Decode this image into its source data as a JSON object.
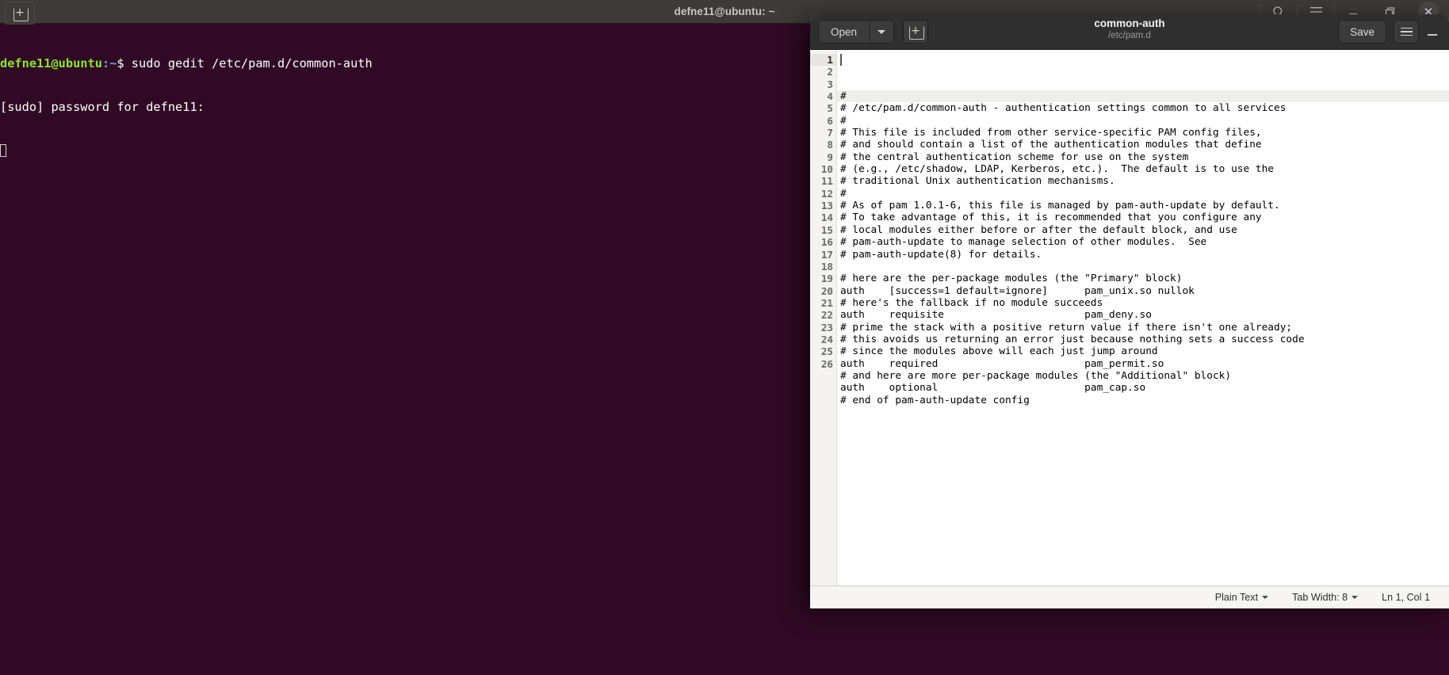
{
  "terminal": {
    "title": "defne11@ubuntu: ~",
    "newtab_icon": "new-tab-icon",
    "search_icon": "search-icon",
    "menu_icon": "hamburger-menu-icon",
    "minimize_icon": "minimize-icon",
    "maximize_icon": "maximize-icon",
    "close_icon": "close-icon",
    "prompt_user": "defne11@ubuntu",
    "prompt_path": ":~",
    "prompt_symbol": "$ ",
    "command": "sudo gedit /etc/pam.d/common-auth",
    "password_prompt": "[sudo] password for defne11:"
  },
  "gedit": {
    "open_label": "Open",
    "open_dropdown_icon": "chevron-down-icon",
    "newtab_icon": "new-tab-icon",
    "doc_title": "common-auth",
    "doc_path": "/etc/pam.d",
    "save_label": "Save",
    "menu_icon": "hamburger-menu-icon",
    "minimize_icon": "minimize-icon",
    "statusbar": {
      "language": "Plain Text",
      "tab_width": "Tab Width: 8",
      "cursor_position": "Ln 1, Col 1"
    },
    "lines": [
      "#",
      "# /etc/pam.d/common-auth - authentication settings common to all services",
      "#",
      "# This file is included from other service-specific PAM config files,",
      "# and should contain a list of the authentication modules that define",
      "# the central authentication scheme for use on the system",
      "# (e.g., /etc/shadow, LDAP, Kerberos, etc.).  The default is to use the",
      "# traditional Unix authentication mechanisms.",
      "#",
      "# As of pam 1.0.1-6, this file is managed by pam-auth-update by default.",
      "# To take advantage of this, it is recommended that you configure any",
      "# local modules either before or after the default block, and use",
      "# pam-auth-update to manage selection of other modules.  See",
      "# pam-auth-update(8) for details.",
      "",
      "# here are the per-package modules (the \"Primary\" block)",
      "auth    [success=1 default=ignore]      pam_unix.so nullok",
      "# here's the fallback if no module succeeds",
      "auth    requisite                       pam_deny.so",
      "# prime the stack with a positive return value if there isn't one already;",
      "# this avoids us returning an error just because nothing sets a success code",
      "# since the modules above will each just jump around",
      "auth    required                        pam_permit.so",
      "# and here are more per-package modules (the \"Additional\" block)",
      "auth    optional                        pam_cap.so",
      "# end of pam-auth-update config"
    ]
  },
  "colors": {
    "terminal_bg": "#300a24",
    "terminal_titlebar": "#3c3b37",
    "prompt_green": "#8ae234",
    "prompt_blue": "#729fcf",
    "gedit_header": "#2f2f2f",
    "gedit_statusbar": "#f6f5f4"
  }
}
